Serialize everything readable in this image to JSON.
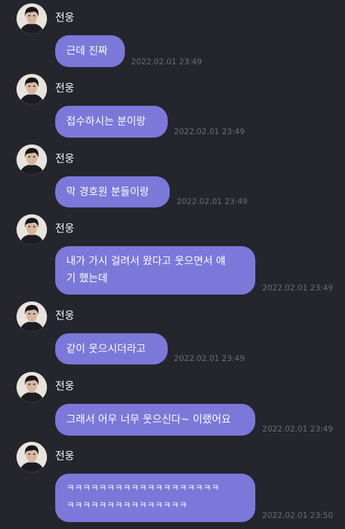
{
  "messages": [
    {
      "sender": "전웅",
      "lines": [
        "근데 진짜"
      ],
      "time": "2022.02.01 23:49"
    },
    {
      "sender": "전웅",
      "lines": [
        "접수하시는 분이랑"
      ],
      "time": "2022.02.01 23:49"
    },
    {
      "sender": "전웅",
      "lines": [
        "막 경호원 분들이랑"
      ],
      "time": "2022.02.01 23:49"
    },
    {
      "sender": "전웅",
      "lines": [
        "내가 가시 걸려서 왔다고 웃으면서 얘",
        "기 했는데"
      ],
      "time": "2022.02.01 23:49"
    },
    {
      "sender": "전웅",
      "lines": [
        "같이 웃으시더라고"
      ],
      "time": "2022.02.01 23:49"
    },
    {
      "sender": "전웅",
      "lines": [
        "그래서 어우 너무 웃으신다~ 이랬어요"
      ],
      "time": "2022.02.01 23:49"
    },
    {
      "sender": "전웅",
      "lines": [
        "ㅋㅋㅋㅋㅋㅋㅋㅋㅋㅋㅋㅋㅋㅋㅋㅋㅋㅋㅋ",
        "ㅋㅋㅋㅋㅋㅋㅋㅋㅋㅋㅋㅋㅋㅋㅋ"
      ],
      "time": "2022.02.01 23:50"
    }
  ]
}
